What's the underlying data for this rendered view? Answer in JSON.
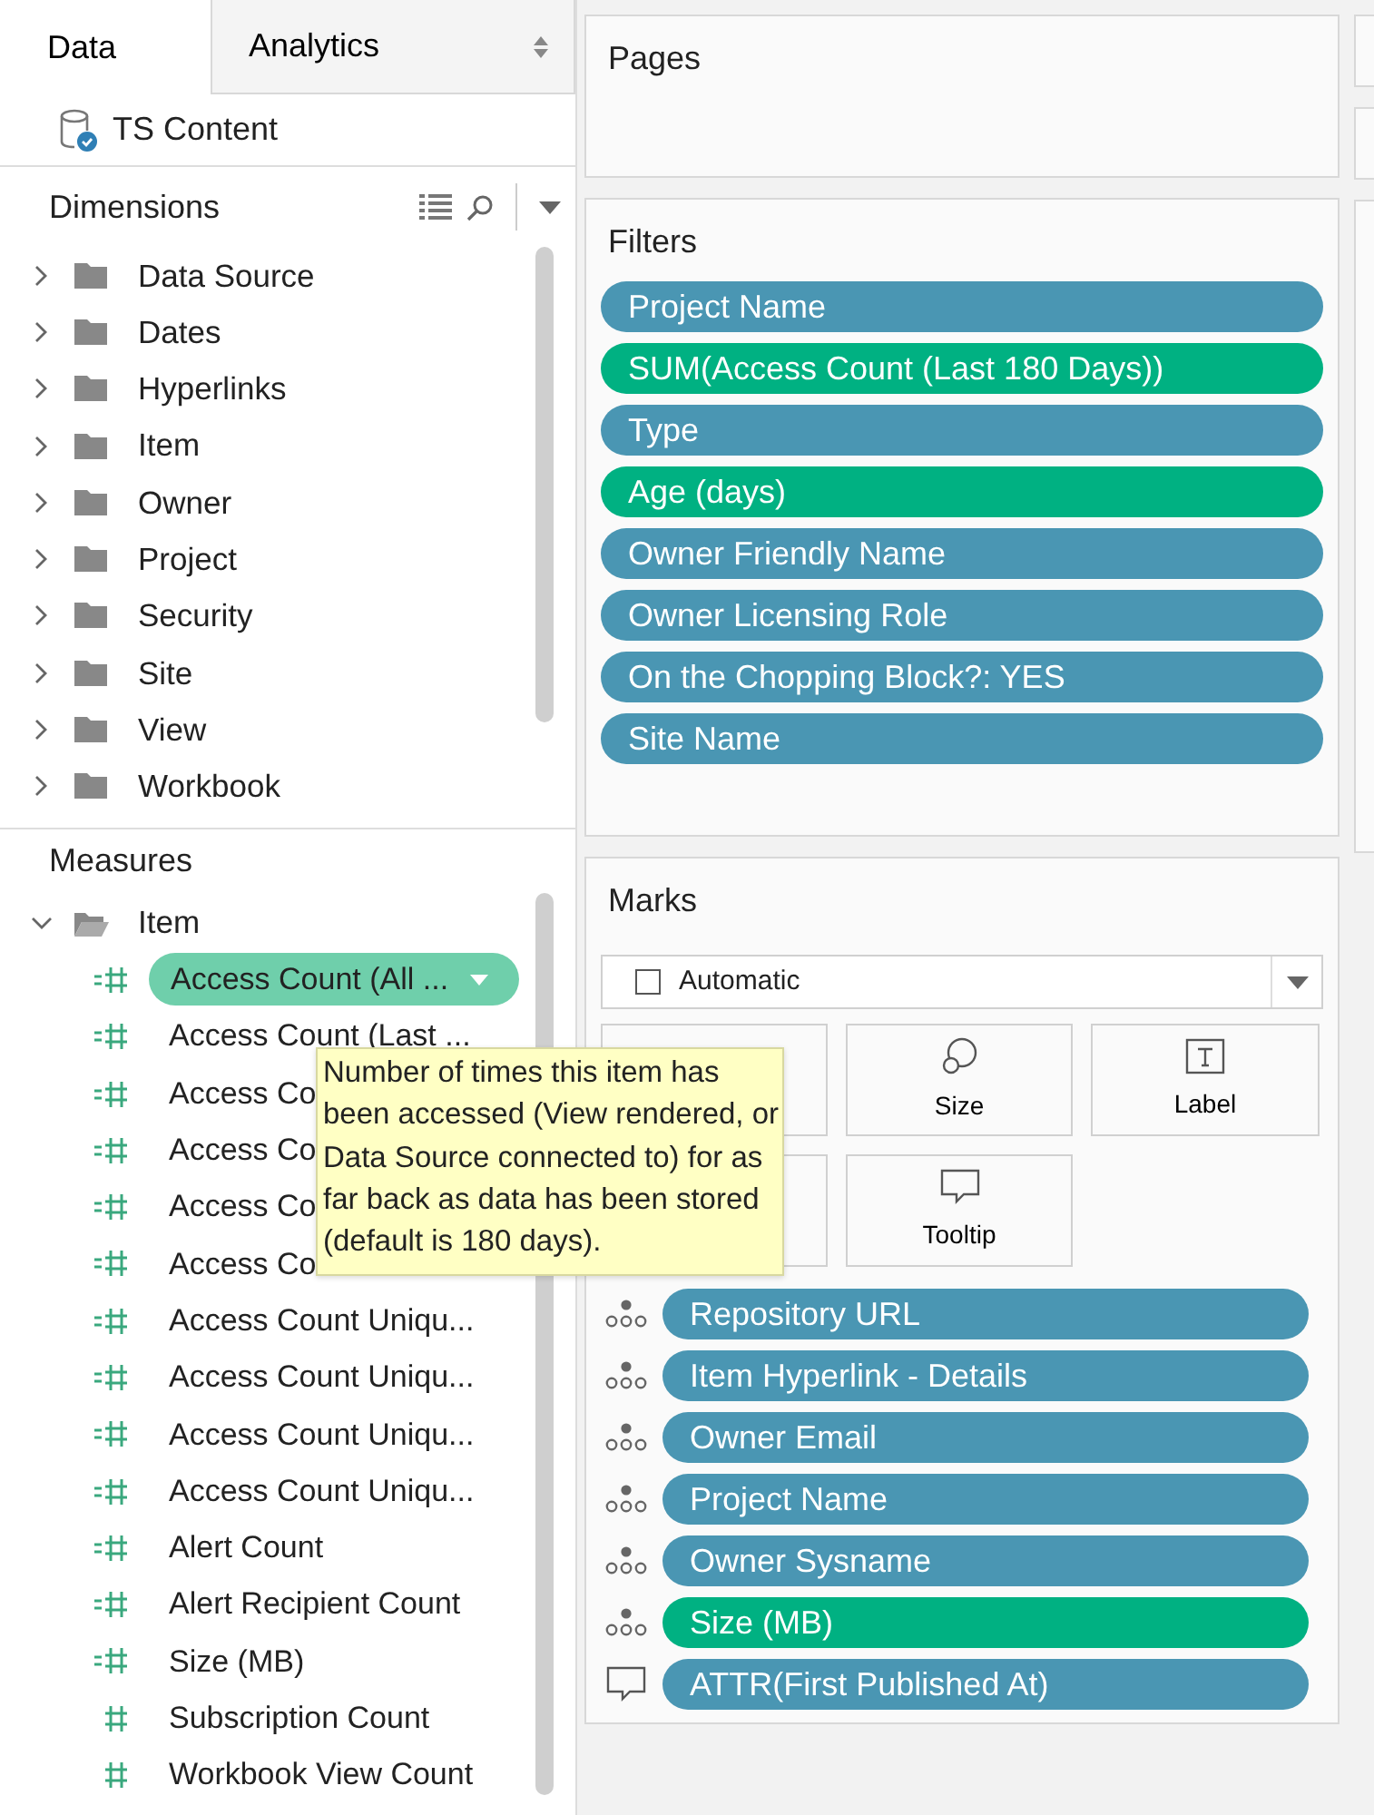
{
  "tabs": [
    {
      "label": "Data",
      "selected": true
    },
    {
      "label": "Analytics",
      "selected": false
    }
  ],
  "data_source": {
    "name": "TS Content"
  },
  "dimensions": {
    "title": "Dimensions",
    "items": [
      {
        "label": "Data Source",
        "expanded": false
      },
      {
        "label": "Dates",
        "expanded": false
      },
      {
        "label": "Hyperlinks",
        "expanded": false
      },
      {
        "label": "Item",
        "expanded": false
      },
      {
        "label": "Owner",
        "expanded": false
      },
      {
        "label": "Project",
        "expanded": false
      },
      {
        "label": "Security",
        "expanded": false
      },
      {
        "label": "Site",
        "expanded": false
      },
      {
        "label": "View",
        "expanded": false
      },
      {
        "label": "Workbook",
        "expanded": false
      }
    ]
  },
  "measures": {
    "title": "Measures",
    "items": [
      {
        "label": "Item",
        "expanded": true,
        "children": [
          {
            "label": "Access Count (All ...",
            "kind": "calc",
            "selected": true
          },
          {
            "label": "Access Count (Last ...",
            "kind": "calc",
            "selected": false
          },
          {
            "label": "Access Co",
            "kind": "calc",
            "selected": false
          },
          {
            "label": "Access Co",
            "kind": "calc",
            "selected": false
          },
          {
            "label": "Access Co",
            "kind": "calc",
            "selected": false
          },
          {
            "label": "Access Co",
            "kind": "calc",
            "selected": false
          },
          {
            "label": "Access Count Uniqu...",
            "kind": "calc",
            "selected": false
          },
          {
            "label": "Access Count Uniqu...",
            "kind": "calc",
            "selected": false
          },
          {
            "label": "Access Count Uniqu...",
            "kind": "calc",
            "selected": false
          },
          {
            "label": "Access Count Uniqu...",
            "kind": "calc",
            "selected": false
          },
          {
            "label": "Alert Count",
            "kind": "calc",
            "selected": false
          },
          {
            "label": "Alert Recipient Count",
            "kind": "calc",
            "selected": false
          },
          {
            "label": "Size (MB)",
            "kind": "calc",
            "selected": false
          },
          {
            "label": "Subscription Count",
            "kind": "base",
            "selected": false
          },
          {
            "label": "Workbook View Count",
            "kind": "base",
            "selected": false
          }
        ]
      }
    ]
  },
  "tooltip": {
    "text": "Number of times this item has been accessed (View rendered, or Data Source connected to) for as far back as data has been stored (default is 180 days)."
  },
  "pages": {
    "title": "Pages"
  },
  "filters": {
    "title": "Filters",
    "pills": [
      {
        "label": "Project Name",
        "color": "#4a96b3"
      },
      {
        "label": "SUM(Access Count (Last 180 Days))",
        "color": "#00b182"
      },
      {
        "label": "Type",
        "color": "#4a96b3"
      },
      {
        "label": "Age (days)",
        "color": "#00b182"
      },
      {
        "label": "Owner Friendly Name",
        "color": "#4a96b3"
      },
      {
        "label": "Owner Licensing Role",
        "color": "#4a96b3"
      },
      {
        "label": "On the Chopping Block?: YES",
        "color": "#4a96b3"
      },
      {
        "label": "Site Name",
        "color": "#4a96b3"
      }
    ]
  },
  "marks": {
    "title": "Marks",
    "mark_type": "Automatic",
    "cards": [
      {
        "kind": "covered"
      },
      {
        "label": "Size",
        "kind": "size"
      },
      {
        "label": "Label",
        "kind": "label"
      },
      {
        "kind": "covered"
      },
      {
        "label": "Tooltip",
        "kind": "tooltip"
      }
    ],
    "pills": [
      {
        "label": "Repository URL",
        "color": "#4a96b3",
        "kind": "detail"
      },
      {
        "label": "Item Hyperlink - Details",
        "color": "#4a96b3",
        "kind": "detail"
      },
      {
        "label": "Owner Email",
        "color": "#4a96b3",
        "kind": "detail"
      },
      {
        "label": "Project Name",
        "color": "#4a96b3",
        "kind": "detail"
      },
      {
        "label": "Owner Sysname",
        "color": "#4a96b3",
        "kind": "detail"
      },
      {
        "label": "Size (MB)",
        "color": "#00b182",
        "kind": "detail"
      },
      {
        "label": "ATTR(First Published At)",
        "color": "#4a96b3",
        "kind": "tooltip"
      }
    ]
  }
}
